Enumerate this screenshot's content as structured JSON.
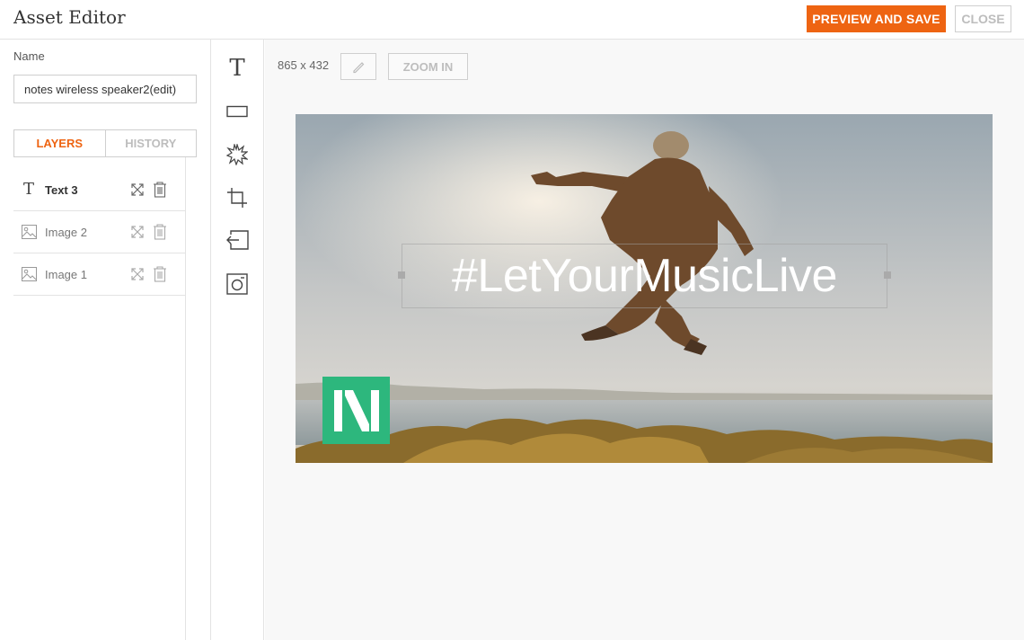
{
  "header": {
    "title": "Asset Editor",
    "preview_save_label": "PREVIEW AND SAVE",
    "close_label": "CLOSE"
  },
  "left_panel": {
    "name_label": "Name",
    "name_value": "notes wireless speaker2(edit)",
    "tabs": [
      {
        "label": "LAYERS",
        "active": true
      },
      {
        "label": "HISTORY",
        "active": false
      }
    ],
    "layers": [
      {
        "name": "Text 3",
        "type": "text",
        "selected": true
      },
      {
        "name": "Image 2",
        "type": "image",
        "selected": false
      },
      {
        "name": "Image 1",
        "type": "image",
        "selected": false
      }
    ]
  },
  "tools": [
    {
      "icon": "text-tool-icon"
    },
    {
      "icon": "rectangle-tool-icon"
    },
    {
      "icon": "burst-shape-icon"
    },
    {
      "icon": "crop-icon"
    },
    {
      "icon": "import-image-icon"
    },
    {
      "icon": "photo-icon"
    }
  ],
  "canvas": {
    "dimensions": "865 x 432",
    "zoom_label": "ZOOM IN",
    "headline": "#LetYourMusicLive",
    "logo_letter": "N"
  },
  "colors": {
    "accent": "#ee6412",
    "logo_green": "#2db77d"
  }
}
